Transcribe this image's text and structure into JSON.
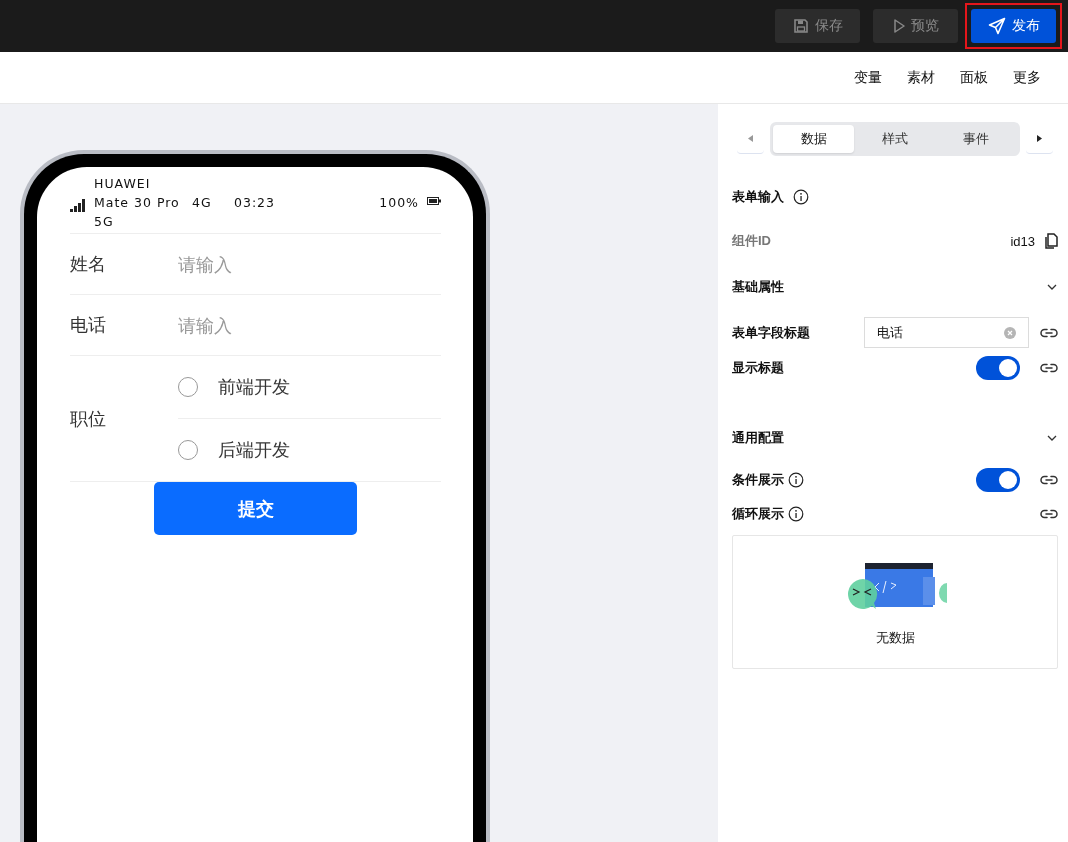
{
  "toolbar": {
    "buttons": [
      {
        "kind": "save",
        "label": "保存",
        "primary": false,
        "highlighted": false
      },
      {
        "kind": "preview",
        "label": "预览",
        "primary": false,
        "highlighted": false
      },
      {
        "kind": "publish",
        "label": "发布",
        "primary": true,
        "highlighted": true
      }
    ]
  },
  "menu": [
    "变量",
    "素材",
    "面板",
    "更多"
  ],
  "phone": {
    "status_bar": {
      "carrier": "HUAWEI Mate 30 Pro 5G",
      "network": "4G",
      "time": "03:23",
      "battery": "100%"
    },
    "form": {
      "fields": [
        {
          "kind": "input",
          "label": "姓名",
          "placeholder": "请输入"
        },
        {
          "kind": "input",
          "label": "电话",
          "placeholder": "请输入"
        },
        {
          "kind": "radio",
          "label": "职位",
          "options": [
            {
              "label": "前端开发",
              "selected": false
            },
            {
              "label": "后端开发",
              "selected": false
            }
          ]
        }
      ],
      "submit": "提交"
    }
  },
  "panel": {
    "tabs": [
      {
        "label": "数据",
        "selected": true
      },
      {
        "label": "样式",
        "selected": false
      },
      {
        "label": "事件",
        "selected": false
      }
    ],
    "title": "表单输入",
    "component_id": {
      "label": "组件ID",
      "value": "id13"
    },
    "sections": [
      {
        "title": "基础属性",
        "expanded": true,
        "rows": [
          {
            "kind": "text",
            "label": "表单字段标题",
            "info": false,
            "value": "电话"
          },
          {
            "kind": "switch",
            "label": "显示标题",
            "info": false,
            "on": true
          }
        ]
      },
      {
        "title": "通用配置",
        "expanded": true,
        "rows": [
          {
            "kind": "switch",
            "label": "条件展示",
            "info": true,
            "on": true
          },
          {
            "kind": "list",
            "label": "循环展示",
            "info": true,
            "empty_text": "无数据"
          }
        ]
      }
    ]
  }
}
